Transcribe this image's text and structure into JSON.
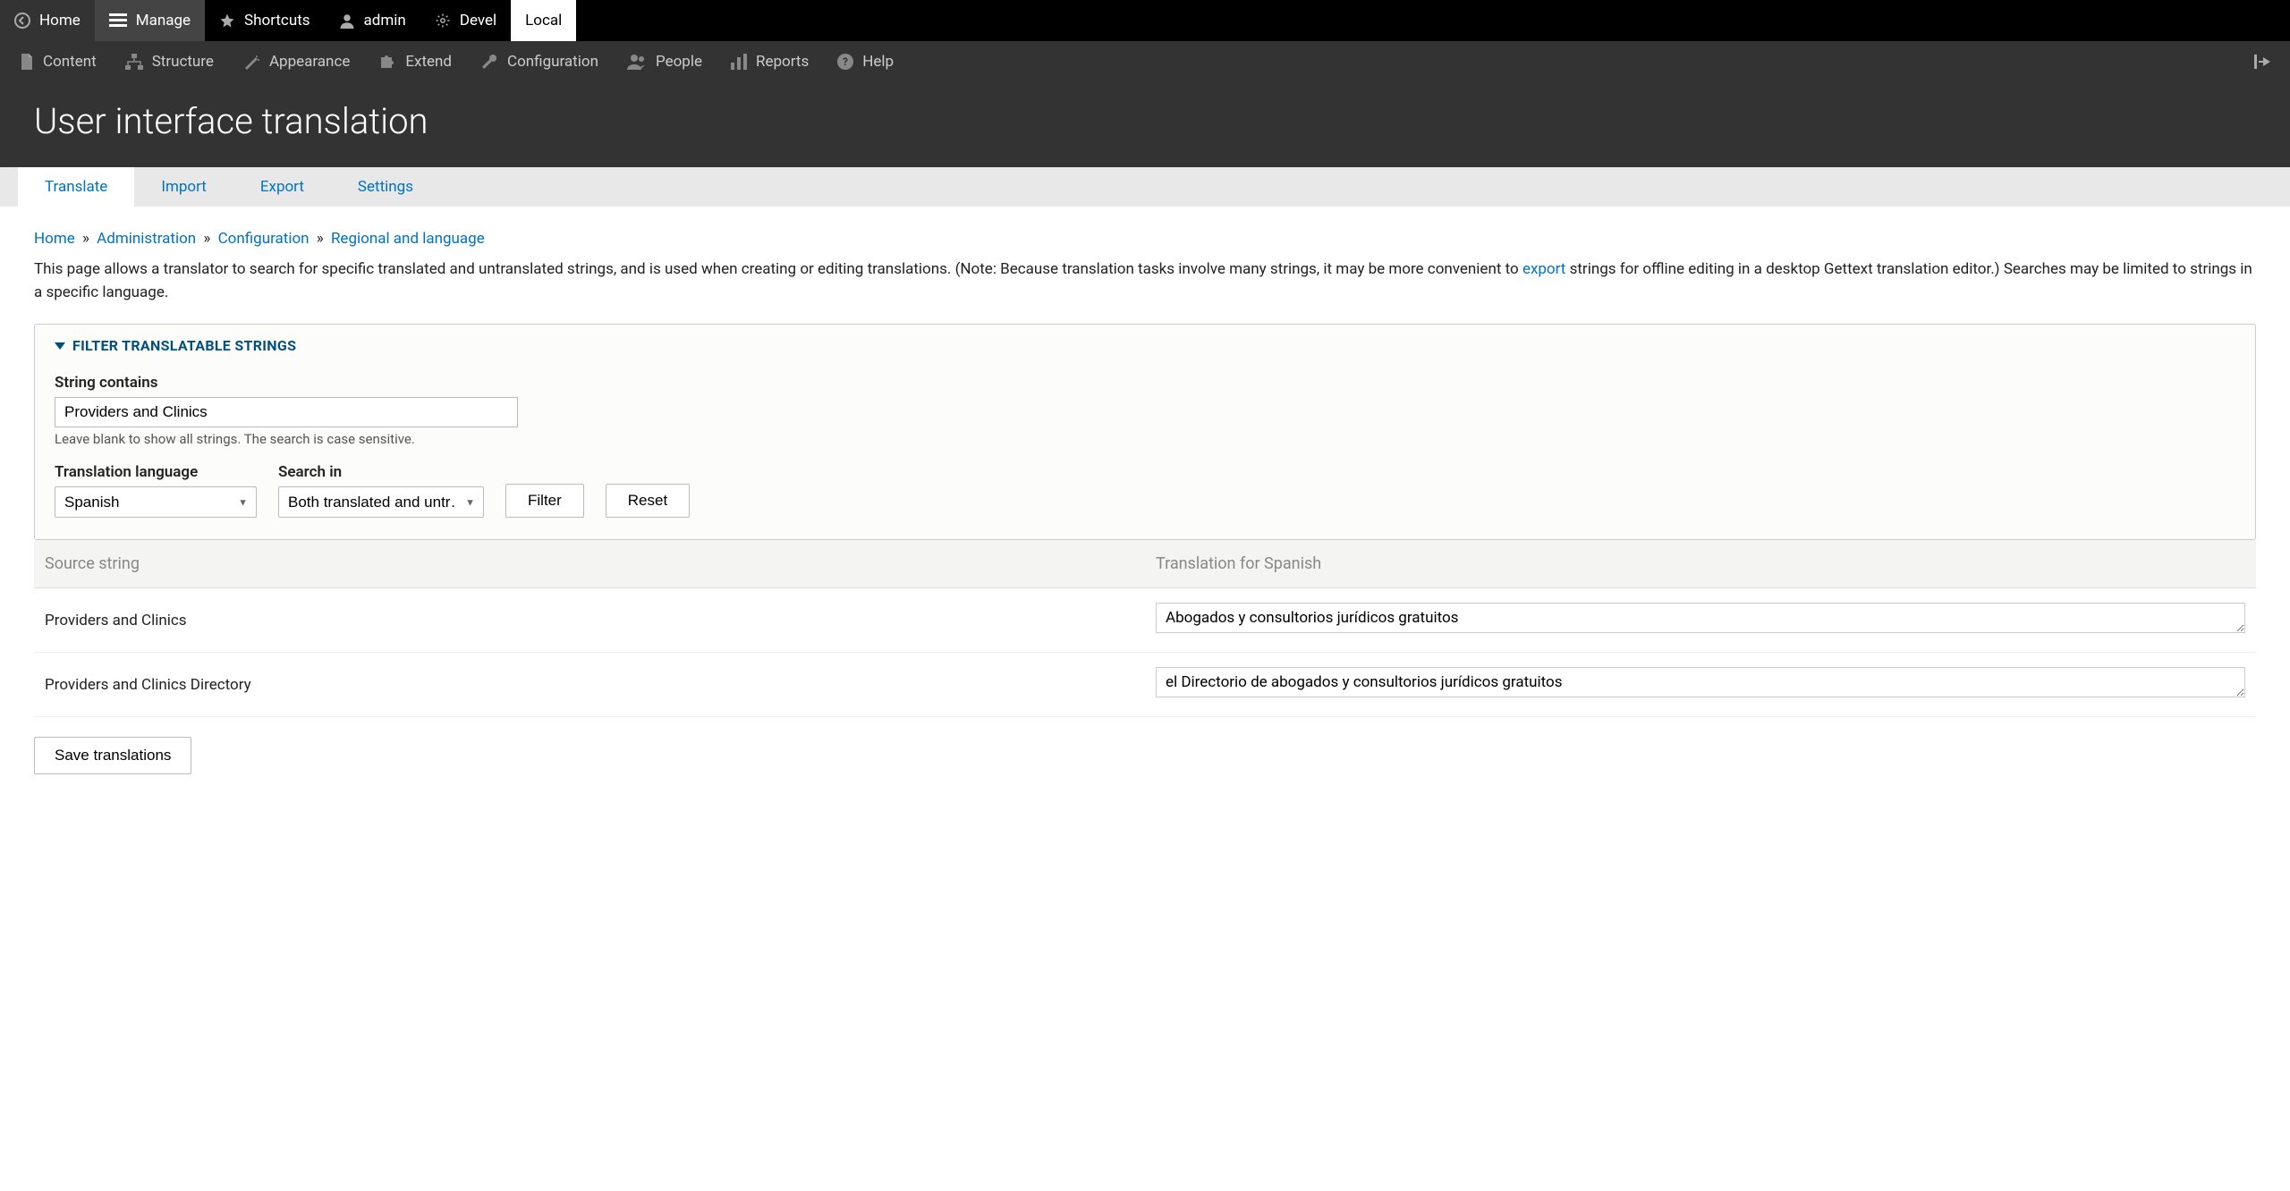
{
  "toolbar_top": {
    "home": "Home",
    "manage": "Manage",
    "shortcuts": "Shortcuts",
    "admin": "admin",
    "devel": "Devel",
    "local": "Local"
  },
  "toolbar_admin": {
    "content": "Content",
    "structure": "Structure",
    "appearance": "Appearance",
    "extend": "Extend",
    "configuration": "Configuration",
    "people": "People",
    "reports": "Reports",
    "help": "Help"
  },
  "page_title": "User interface translation",
  "tabs": {
    "translate": "Translate",
    "import": "Import",
    "export": "Export",
    "settings": "Settings"
  },
  "breadcrumb": {
    "home": "Home",
    "administration": "Administration",
    "configuration": "Configuration",
    "regional": "Regional and language"
  },
  "intro": {
    "part1": "This page allows a translator to search for specific translated and untranslated strings, and is used when creating or editing translations. (Note: Because translation tasks involve many strings, it may be more convenient to ",
    "export_link": "export",
    "part2": " strings for offline editing in a desktop Gettext translation editor.) Searches may be limited to strings in a specific language."
  },
  "fieldset": {
    "legend": "Filter translatable strings",
    "string_contains_label": "String contains",
    "string_contains_value": "Providers and Clinics",
    "string_contains_help": "Leave blank to show all strings. The search is case sensitive.",
    "language_label": "Translation language",
    "language_value": "Spanish",
    "search_in_label": "Search in",
    "search_in_value": "Both translated and untr…",
    "filter_btn": "Filter",
    "reset_btn": "Reset"
  },
  "table": {
    "col_source": "Source string",
    "col_translation": "Translation for Spanish",
    "rows": [
      {
        "source": "Providers and Clinics",
        "translation": "Abogados y consultorios jurídicos gratuitos"
      },
      {
        "source": "Providers and Clinics Directory",
        "translation": "el Directorio de abogados y consultorios jurídicos gratuitos"
      }
    ]
  },
  "save_btn": "Save translations"
}
